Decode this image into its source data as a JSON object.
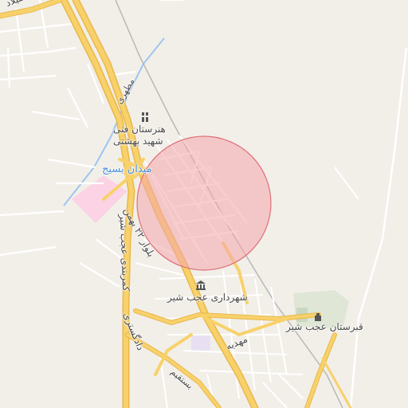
{
  "map": {
    "labels": {
      "shahrak_milad": "شهرک میلاد",
      "motahari": "مطهری",
      "honarestan_line1": "هنرستان فنی",
      "honarestan_line2": "شهید بهشتی",
      "meydan_basij": "میدان بسیج",
      "bolvar_22_bahman": "بلوار ۲۲ بهمن",
      "kamarbandi": "کمربندی عجب شیر",
      "shahrdari": "شهرداری عجب شیر",
      "dadgostari": "دادگستری",
      "mahdie": "مهدیه",
      "qabrestan": "قبرستان عجب شیر",
      "mostaghim": "بستقیم"
    },
    "highlight_circle": {
      "color": "#f4a6ab"
    },
    "colors": {
      "background": "#f2efe9",
      "major_road": "#f8d16b",
      "road_casing": "#e8b84a",
      "minor_road": "#ffffff",
      "railway": "#b8b8b8",
      "river": "#9ec5f0",
      "park": "#d9e6cf",
      "pink_zone": "#fbd3e4",
      "label_blue": "#4a90d9"
    },
    "icons": [
      "school-icon",
      "town-hall-icon",
      "cemetery-icon"
    ]
  }
}
